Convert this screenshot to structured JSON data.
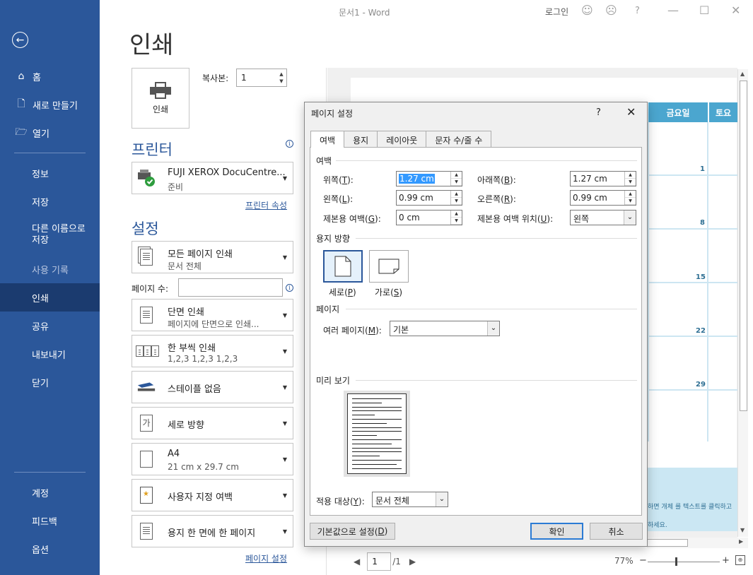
{
  "window": {
    "title": "문서1  -  Word",
    "login": "로그인",
    "help": "?"
  },
  "sidebar": {
    "items": [
      {
        "label": "홈"
      },
      {
        "label": "새로 만들기"
      },
      {
        "label": "열기"
      },
      {
        "label": "정보"
      },
      {
        "label": "저장"
      },
      {
        "label": "다른 이름으로 저장"
      },
      {
        "label": "사용 기록"
      },
      {
        "label": "인쇄"
      },
      {
        "label": "공유"
      },
      {
        "label": "내보내기"
      },
      {
        "label": "닫기"
      }
    ],
    "bottom": [
      {
        "label": "계정"
      },
      {
        "label": "피드백"
      },
      {
        "label": "옵션"
      }
    ]
  },
  "print": {
    "title": "인쇄",
    "button": "인쇄",
    "copies_label": "복사본:",
    "copies_value": "1",
    "printer_title": "프린터",
    "printer_name": "FUJI XEROX DocuCentre...",
    "printer_status": "준비",
    "printer_props": "프린터 속성",
    "settings_title": "설정",
    "settings": [
      {
        "line1": "모든 페이지 인쇄",
        "line2": "문서 전체"
      },
      {
        "line1": "단면 인쇄",
        "line2": "페이지에 단면으로 인쇄..."
      },
      {
        "line1": "한 부씩 인쇄",
        "line2": "1,2,3     1,2,3     1,2,3"
      },
      {
        "line1": "스테이플 없음",
        "line2": ""
      },
      {
        "line1": "세로 방향",
        "line2": ""
      },
      {
        "line1": "A4",
        "line2": "21 cm x 29.7 cm"
      },
      {
        "line1": "사용자 지정 여백",
        "line2": ""
      },
      {
        "line1": "용지 한 면에 한 페이지",
        "line2": ""
      }
    ],
    "pages_label": "페이지 수:",
    "pages_value": "",
    "page_setup_link": "페이지 설정",
    "portrait_glyph": "가"
  },
  "preview": {
    "headers": [
      "금요일",
      "토요"
    ],
    "days": [
      "1",
      "8",
      "15",
      "22",
      "29"
    ],
    "footer_line1": "하면 개체 를 텍스트를 클릭하고",
    "footer_line2": "하세요.",
    "page_current": "1",
    "page_total": "/1",
    "zoom": "77%",
    "zoom_minus": "−",
    "zoom_plus": "+"
  },
  "dialog": {
    "title": "페이지 설정",
    "help": "?",
    "tabs": [
      "여백",
      "용지",
      "레이아웃",
      "문자 수/줄 수"
    ],
    "margins_group": "여백",
    "top_label": "위쪽(",
    "top_key": "T",
    "top_value": "1.27 cm",
    "bottom_label": "아래쪽(",
    "bottom_key": "B",
    "bottom_value": "1.27 cm",
    "left_label": "왼쪽(",
    "left_key": "L",
    "left_value": "0.99 cm",
    "right_label": "오른쪽(",
    "right_key": "R",
    "right_value": "0.99 cm",
    "gutter_label": "제본용 여백(",
    "gutter_key": "G",
    "gutter_value": "0 cm",
    "gutter_pos_label": "제본용 여백 위치(",
    "gutter_pos_key": "U",
    "gutter_pos_value": "왼쪽",
    "orientation_group": "용지 방향",
    "portrait": "세로(",
    "portrait_key": "P",
    "landscape": "가로(",
    "landscape_key": "S",
    "pages_group": "페이지",
    "multi_pages_label": "여러 페이지(",
    "multi_pages_key": "M",
    "multi_pages_value": "기본",
    "preview_group": "미리 보기",
    "apply_label": "적용 대상(",
    "apply_key": "Y",
    "apply_value": "문서 전체",
    "default_btn": "기본값으로 설정(",
    "default_key": "D",
    "ok": "확인",
    "cancel": "취소"
  }
}
